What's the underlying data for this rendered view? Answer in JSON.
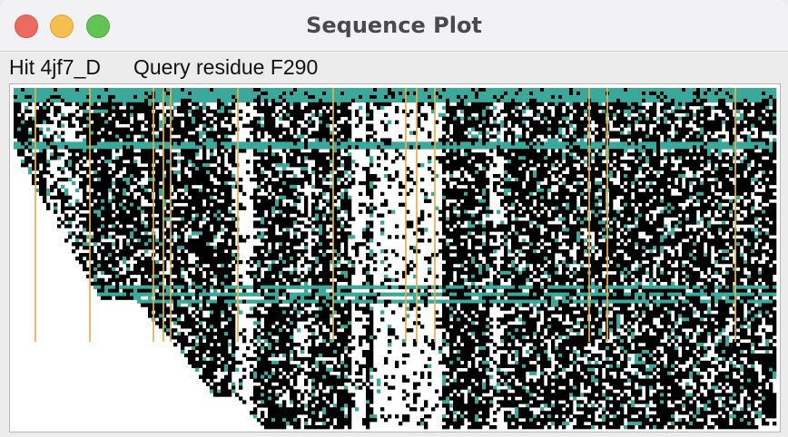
{
  "window": {
    "title": "Sequence Plot"
  },
  "traffic_lights": {
    "close_color": "#ed6a5e",
    "minimize_color": "#f5bf4f",
    "maximize_color": "#61c454"
  },
  "info": {
    "hit_label": "Hit 4jf7_D",
    "query_label": "Query residue F290"
  },
  "plot": {
    "description_colors": {
      "match": "#000000",
      "conserved": "#3aa89a",
      "query_marker": "#e8b04a",
      "gap": "#ffffff"
    }
  }
}
